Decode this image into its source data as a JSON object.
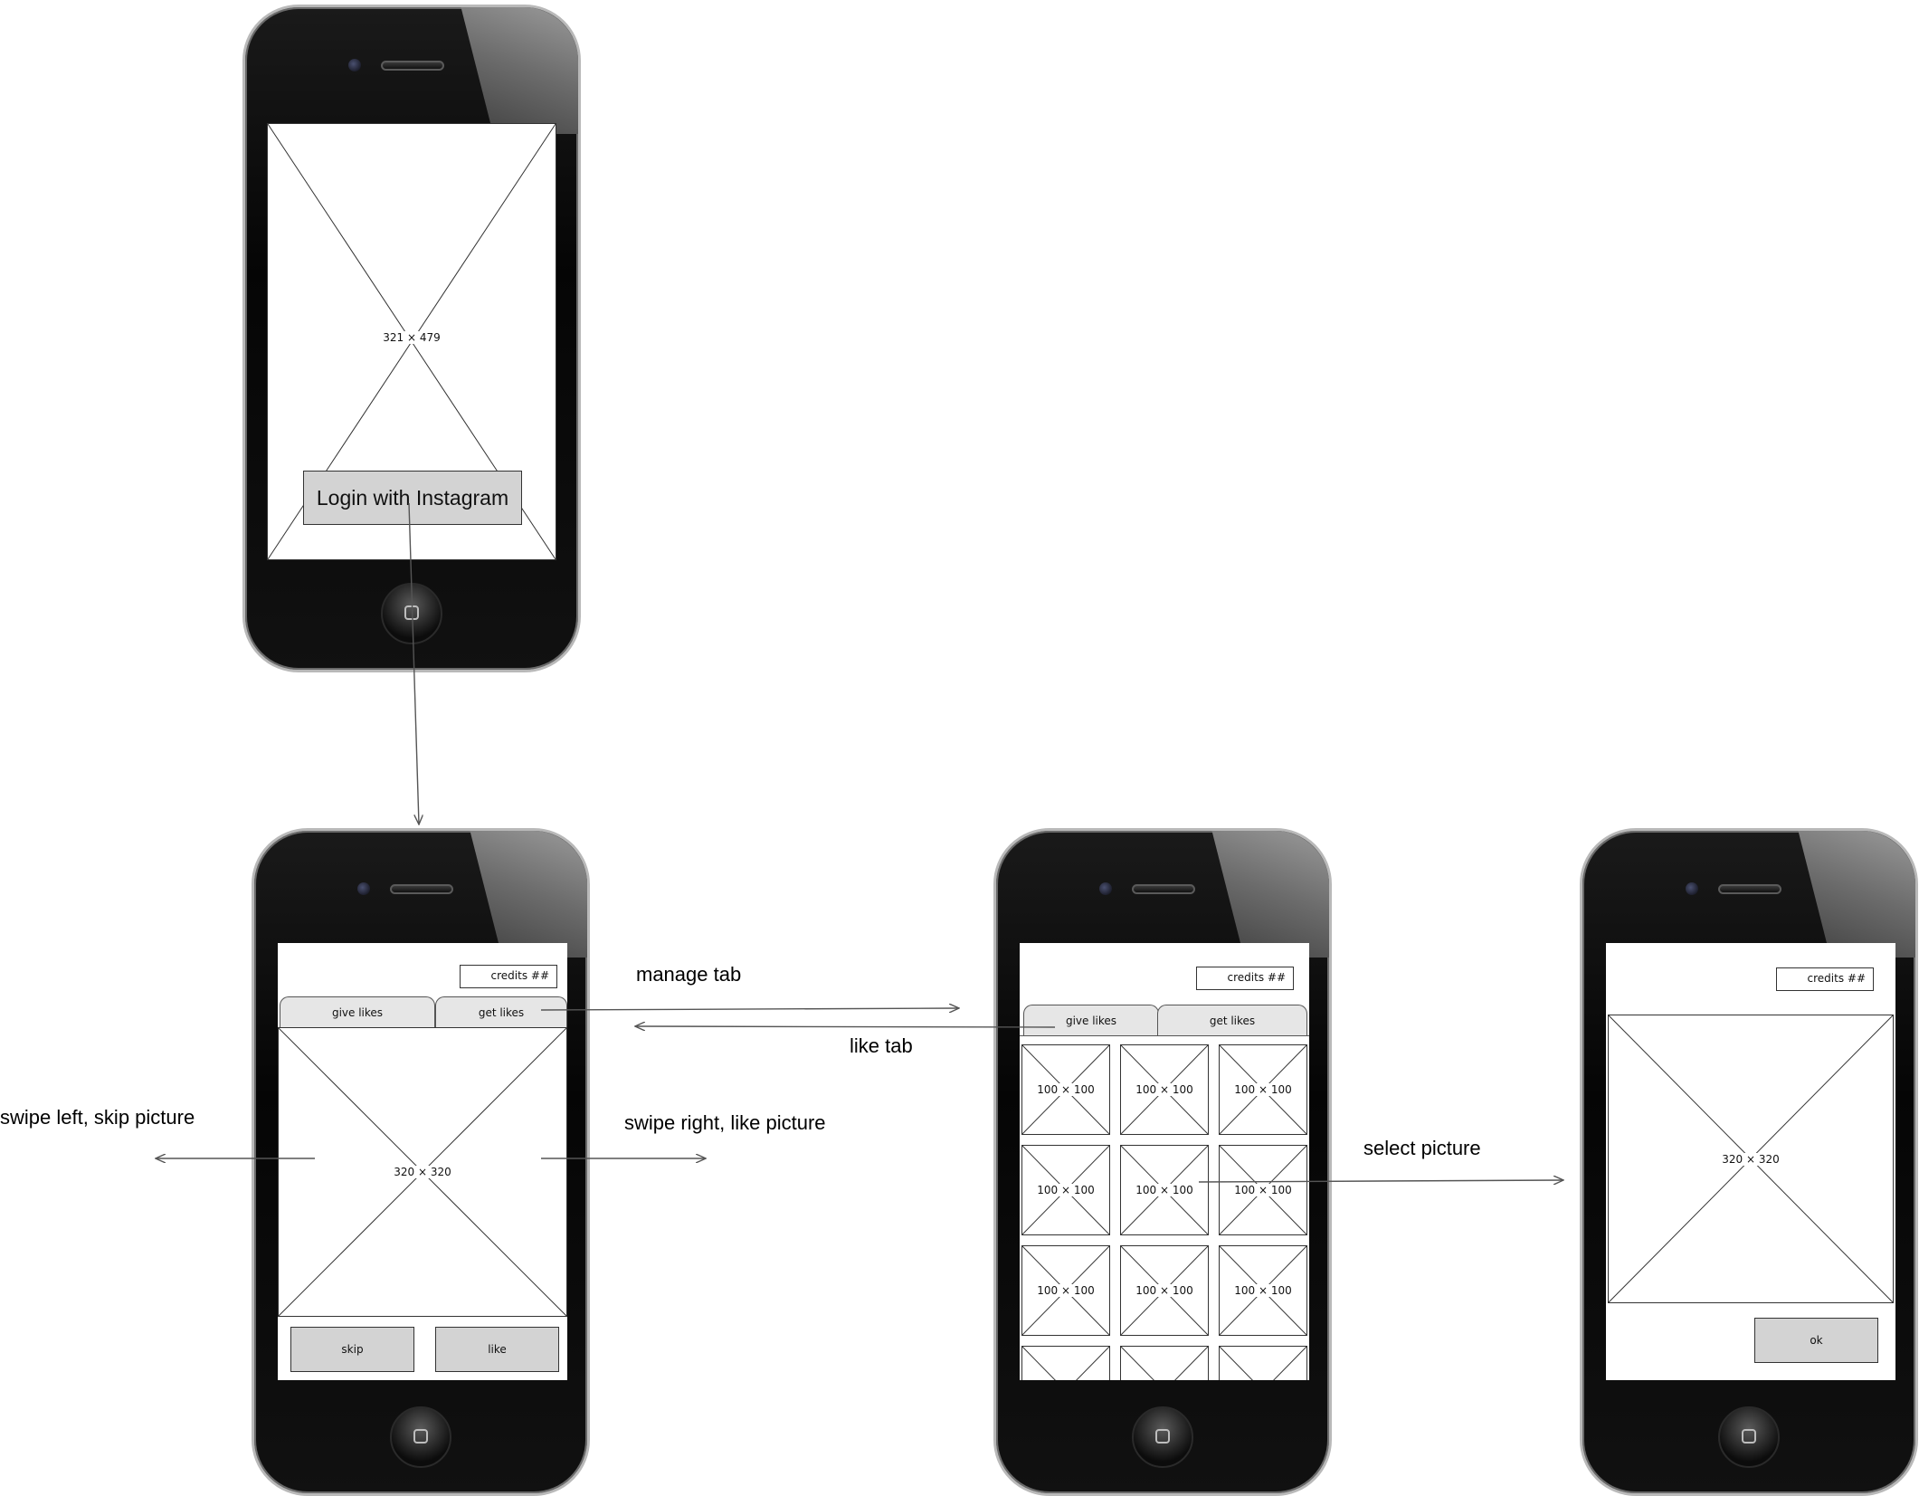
{
  "phone_login": {
    "placeholder_label": "321 × 479",
    "login_button": "Login with Instagram"
  },
  "phone_give": {
    "credits": "credits ##",
    "tab_give": "give likes",
    "tab_get": "get likes",
    "placeholder_label": "320 × 320",
    "skip_button": "skip",
    "like_button": "like"
  },
  "phone_grid": {
    "credits": "credits ##",
    "tab_give": "give likes",
    "tab_get": "get likes",
    "thumb_label": "100 × 100"
  },
  "phone_select": {
    "credits": "credits ##",
    "placeholder_label": "320 × 320",
    "ok_button": "ok"
  },
  "annotations": {
    "manage_tab": "manage tab",
    "like_tab": "like tab",
    "swipe_left": "swipe left, skip picture",
    "swipe_right": "swipe right, like picture",
    "select_picture": "select picture"
  },
  "colors": {
    "button_fill": "#d3d3d3",
    "tab_fill": "#e6e6e6",
    "arrow": "#555555"
  }
}
